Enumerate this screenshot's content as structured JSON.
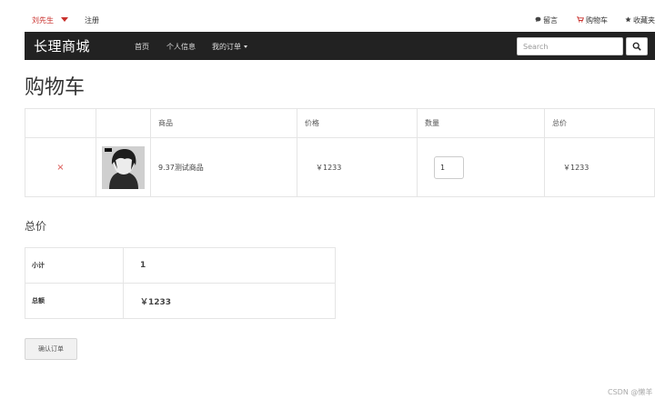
{
  "topbar": {
    "user_name": "刘先生",
    "register": "注册",
    "messages": "留言",
    "cart": "购物车",
    "favorites": "收藏夹"
  },
  "navbar": {
    "brand": "长理商城",
    "links": [
      "首页",
      "个人信息",
      "我的订单"
    ],
    "search_placeholder": "Search"
  },
  "page_title": "购物车",
  "cart_table": {
    "headers": [
      "",
      "",
      "商品",
      "价格",
      "数量",
      "总价"
    ],
    "rows": [
      {
        "remove": "×",
        "product_name": "9.37测试商品",
        "price": "￥1233",
        "quantity": "1",
        "total": "￥1233"
      }
    ]
  },
  "totals": {
    "title": "总价",
    "subtotal_label": "小计",
    "subtotal_value": "1",
    "total_label": "总额",
    "total_value": "￥1233"
  },
  "confirm_button": "确认订单",
  "watermark": "CSDN @懒羊",
  "colors": {
    "navbar_bg": "#222222",
    "accent_red": "#c9302c"
  }
}
